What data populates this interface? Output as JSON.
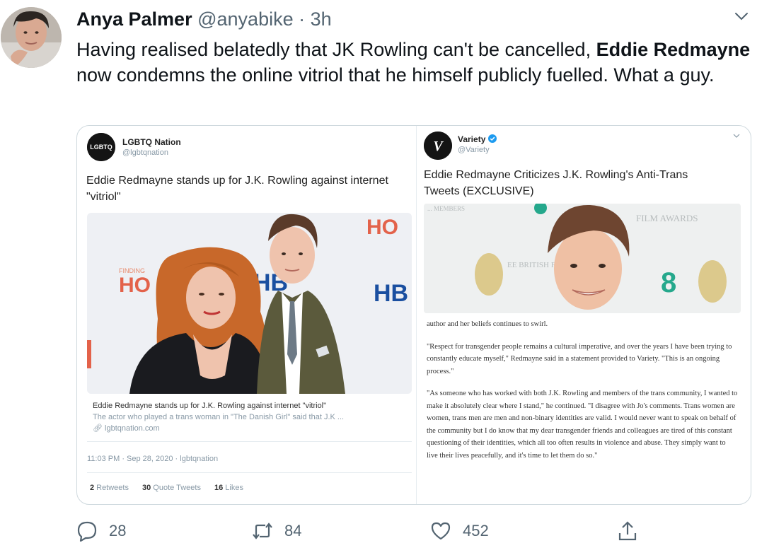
{
  "tweet": {
    "author_name": "Anya Palmer",
    "handle": "@anyabike",
    "separator": "·",
    "time": "3h",
    "text_part1": "Having realised belatedly that JK Rowling can't be cancelled, ",
    "text_bold": "Eddie Redmayne",
    "text_part2": " now condemns the online vitriol that he himself publicly fuelled. What a guy.",
    "more_icon": "chevron-down-icon"
  },
  "left_tweet": {
    "avatar_text": "LGBTQ",
    "name": "LGBTQ Nation",
    "handle": "@lgbtqnation",
    "headline": "Eddie Redmayne stands up for J.K. Rowling against internet \"vitriol\"",
    "photo_sign_left": "HO",
    "photo_sign_small": "FINDING",
    "photo_sign_top": "HO",
    "photo_sign_hbo1": "HB",
    "photo_sign_hbo2": "HB",
    "card_title": "Eddie Redmayne stands up for J.K. Rowling against internet \"vitriol\"",
    "card_desc": "The actor who played a trans woman in \"The Danish Girl\" said that J.K ...",
    "card_domain": "lgbtqnation.com",
    "timestamp": "11:03 PM · Sep 28, 2020 · lgbtqnation",
    "retweets_count": "2",
    "retweets_label": "Retweets",
    "quotes_count": "30",
    "quotes_label": "Quote Tweets",
    "likes_count": "16",
    "likes_label": "Likes"
  },
  "right_tweet": {
    "logo_letter": "V",
    "name": "Variety",
    "handle": "@Variety",
    "headline": "Eddie Redmayne Criticizes J.K. Rowling's Anti-Trans Tweets (EXCLUSIVE)",
    "photo_text_film_awards": "FILM AWARDS",
    "photo_text_top": "... MEMBERS",
    "photo_text_british": "EE BRITISH FILM A",
    "photo_text_8": "8",
    "article_p1": "author and her beliefs continues to swirl.",
    "article_p2": "\"Respect for transgender people remains a cultural imperative, and over the years I have been trying to constantly educate myself,\" Redmayne said in a statement provided to Variety. \"This is an ongoing process.\"",
    "article_p3": "\"As someone who has worked with both J.K. Rowling and members of the trans community, I wanted to make it absolutely clear where I stand,\" he continued. \"I disagree with Jo's comments. Trans women are women, trans men are men and non-binary identities are valid. I would never want to speak on behalf of the community but I do know that my dear transgender friends and colleagues are tired of this constant questioning of their identities, which all too often results in violence and abuse. They simply want to live their lives peacefully, and it's time to let them do so.\""
  },
  "actions": {
    "replies": "28",
    "retweets": "84",
    "likes": "452"
  },
  "colors": {
    "text_primary": "#0f1419",
    "text_secondary": "#536471",
    "border": "#cfd9de",
    "verified": "#1d9bf0"
  }
}
